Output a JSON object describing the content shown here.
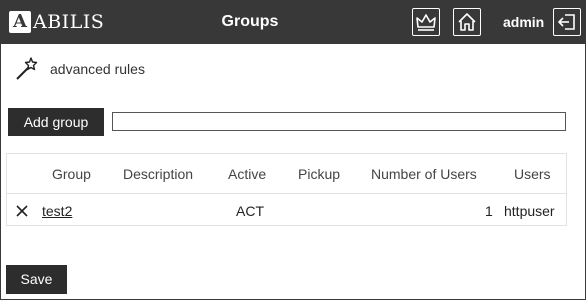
{
  "header": {
    "logo_letter": "A",
    "logo_text": "ABILIS",
    "title": "Groups",
    "user": "admin",
    "crown_icon": "crown-icon",
    "home_icon": "home-icon",
    "logout_icon": "logout-icon"
  },
  "advanced_rules": {
    "label": "advanced rules",
    "icon": "magic-wand-icon"
  },
  "add_group": {
    "button_label": "Add group",
    "input_value": ""
  },
  "table": {
    "columns": [
      "Group",
      "Description",
      "Active",
      "Pickup",
      "Number of Users",
      "Users"
    ],
    "rows": [
      {
        "delete_icon": "close-icon",
        "group": "test2",
        "description": "",
        "active": "ACT",
        "pickup": "",
        "number_of_users": "1",
        "users": "httpuser"
      }
    ]
  },
  "footer": {
    "save_label": "Save"
  }
}
